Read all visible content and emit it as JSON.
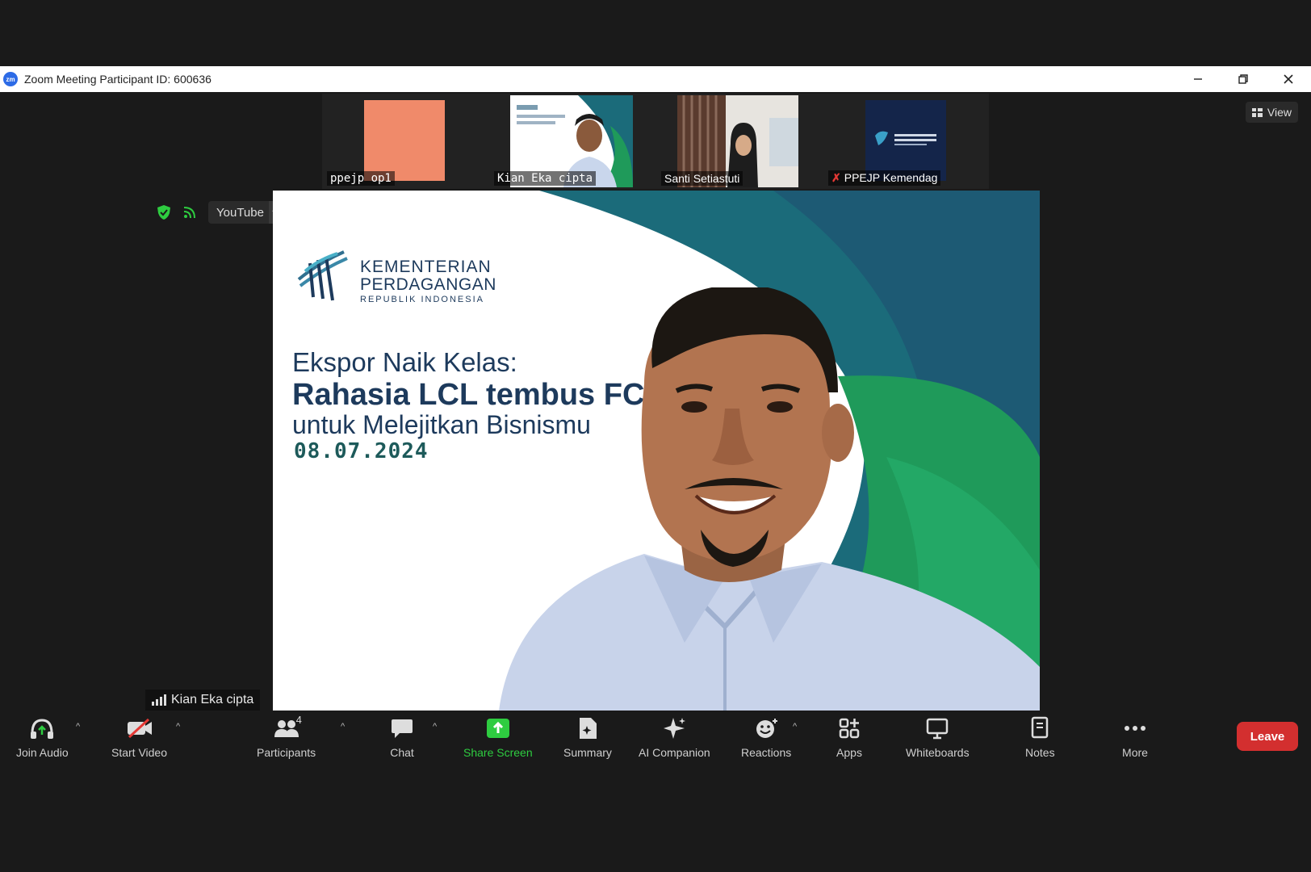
{
  "window": {
    "title": "Zoom Meeting Participant ID: 600636",
    "logo_text": "zm"
  },
  "thumbnails": [
    {
      "name": "ppejp op1"
    },
    {
      "name": "Kian Eka cipta"
    },
    {
      "name": "Santi Setiastuti"
    },
    {
      "name": "PPEJP Kemendag"
    }
  ],
  "view_button": {
    "label": "View"
  },
  "stream": {
    "platform": "YouTube"
  },
  "slide": {
    "org_line1": "KEMENTERIAN",
    "org_line2": "PERDAGANGAN",
    "org_line3": "REPUBLIK INDONESIA",
    "title_line1": "Ekspor Naik Kelas:",
    "title_line2": "Rahasia LCL tembus FCL",
    "title_line3": "untuk Melejitkan Bisnismu",
    "date": "08.07.2024"
  },
  "speaker": {
    "name": "Kian Eka cipta"
  },
  "toolbar": {
    "join_audio": "Join Audio",
    "start_video": "Start Video",
    "participants": "Participants",
    "participants_count": "4",
    "chat": "Chat",
    "share_screen": "Share Screen",
    "summary": "Summary",
    "ai_companion": "AI Companion",
    "reactions": "Reactions",
    "apps": "Apps",
    "whiteboards": "Whiteboards",
    "notes": "Notes",
    "more": "More",
    "leave": "Leave"
  },
  "colors": {
    "leave": "#d32f2f",
    "share_green": "#2ecc40",
    "slide_teal": "#1b6b7a",
    "slide_green": "#1f9a5a",
    "slide_navy": "#1d3a5c"
  }
}
